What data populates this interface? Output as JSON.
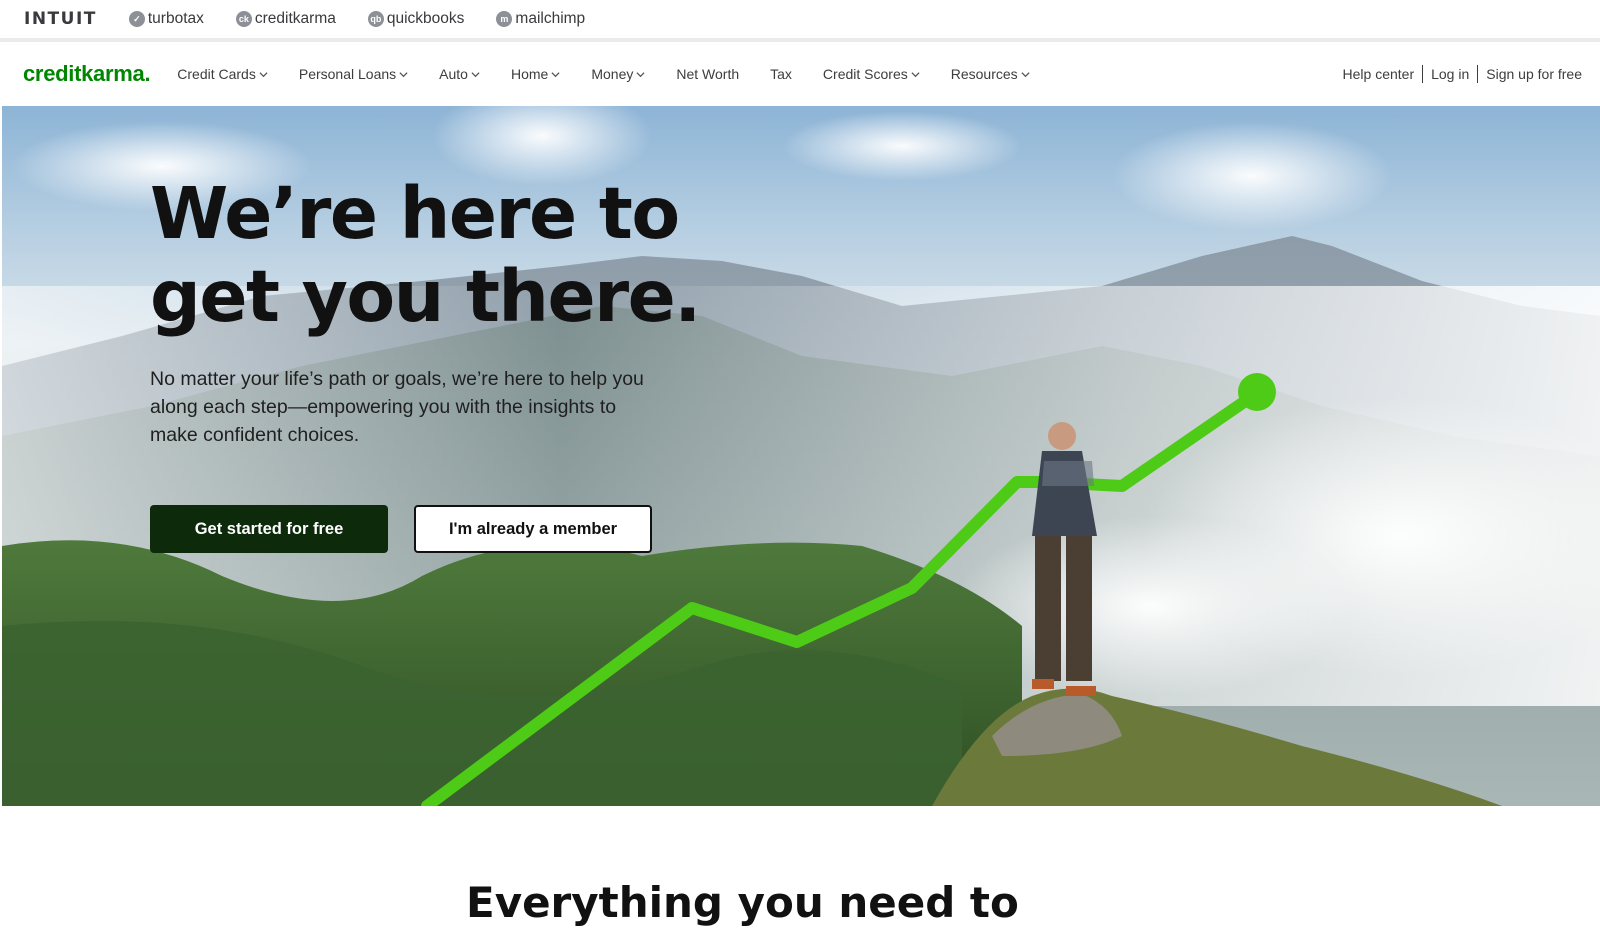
{
  "family_bar": {
    "intuit_logo": "INTUIT",
    "products": [
      {
        "label": "turbotax",
        "icon": "turbotax-check-icon",
        "glyph": "✓"
      },
      {
        "label": "creditkarma",
        "icon": "creditkarma-ck-icon",
        "glyph": "ck"
      },
      {
        "label": "quickbooks",
        "icon": "quickbooks-qb-icon",
        "glyph": "qb"
      },
      {
        "label": "mailchimp",
        "icon": "mailchimp-icon",
        "glyph": "m"
      }
    ]
  },
  "nav": {
    "logo": "creditkarma",
    "logo_dot": ".",
    "items": [
      {
        "label": "Credit Cards",
        "dropdown": true
      },
      {
        "label": "Personal Loans",
        "dropdown": true
      },
      {
        "label": "Auto",
        "dropdown": true
      },
      {
        "label": "Home",
        "dropdown": true
      },
      {
        "label": "Money",
        "dropdown": true
      },
      {
        "label": "Net Worth",
        "dropdown": false
      },
      {
        "label": "Tax",
        "dropdown": false
      },
      {
        "label": "Credit Scores",
        "dropdown": true
      },
      {
        "label": "Resources",
        "dropdown": true
      }
    ],
    "help_center": "Help center",
    "log_in": "Log in",
    "sign_up": "Sign up for free"
  },
  "hero": {
    "title_line1": "We’re here to",
    "title_line2": "get you there.",
    "subtitle": "No matter your life’s path or goals, we’re here to help you along each step—empowering you with the insights to make confident choices.",
    "primary_button": "Get started for free",
    "secondary_button": "I'm already a member"
  },
  "next_section": {
    "heading": "Everything you need to"
  },
  "colors": {
    "brand_green": "#008600",
    "growth_line": "#4ecb16",
    "primary_button_bg": "#0d2a0a"
  }
}
